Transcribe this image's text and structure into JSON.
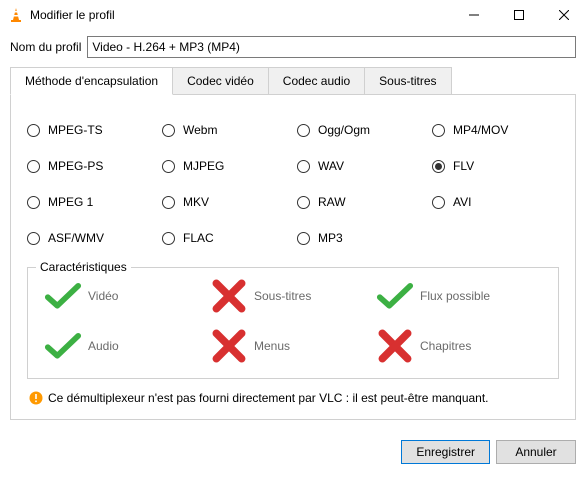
{
  "window": {
    "title": "Modifier le profil"
  },
  "profile": {
    "label": "Nom du profil",
    "value": "Video - H.264 + MP3 (MP4)"
  },
  "tabs": [
    {
      "label": "Méthode d'encapsulation",
      "active": true
    },
    {
      "label": "Codec vidéo",
      "active": false
    },
    {
      "label": "Codec audio",
      "active": false
    },
    {
      "label": "Sous-titres",
      "active": false
    }
  ],
  "formats": [
    {
      "label": "MPEG-TS",
      "checked": false
    },
    {
      "label": "Webm",
      "checked": false
    },
    {
      "label": "Ogg/Ogm",
      "checked": false
    },
    {
      "label": "MP4/MOV",
      "checked": false
    },
    {
      "label": "MPEG-PS",
      "checked": false
    },
    {
      "label": "MJPEG",
      "checked": false
    },
    {
      "label": "WAV",
      "checked": false
    },
    {
      "label": "FLV",
      "checked": true
    },
    {
      "label": "MPEG 1",
      "checked": false
    },
    {
      "label": "MKV",
      "checked": false
    },
    {
      "label": "RAW",
      "checked": false
    },
    {
      "label": "AVI",
      "checked": false
    },
    {
      "label": "ASF/WMV",
      "checked": false
    },
    {
      "label": "FLAC",
      "checked": false
    },
    {
      "label": "MP3",
      "checked": false
    }
  ],
  "characteristics": {
    "legend": "Caractéristiques",
    "items": [
      {
        "label": "Vidéo",
        "ok": true
      },
      {
        "label": "Sous-titres",
        "ok": false
      },
      {
        "label": "Flux possible",
        "ok": true
      },
      {
        "label": "Audio",
        "ok": true
      },
      {
        "label": "Menus",
        "ok": false
      },
      {
        "label": "Chapitres",
        "ok": false
      }
    ]
  },
  "warning": {
    "text": "Ce démultiplexeur n'est pas fourni directement par VLC : il est peut-être manquant."
  },
  "buttons": {
    "save": "Enregistrer",
    "cancel": "Annuler"
  }
}
